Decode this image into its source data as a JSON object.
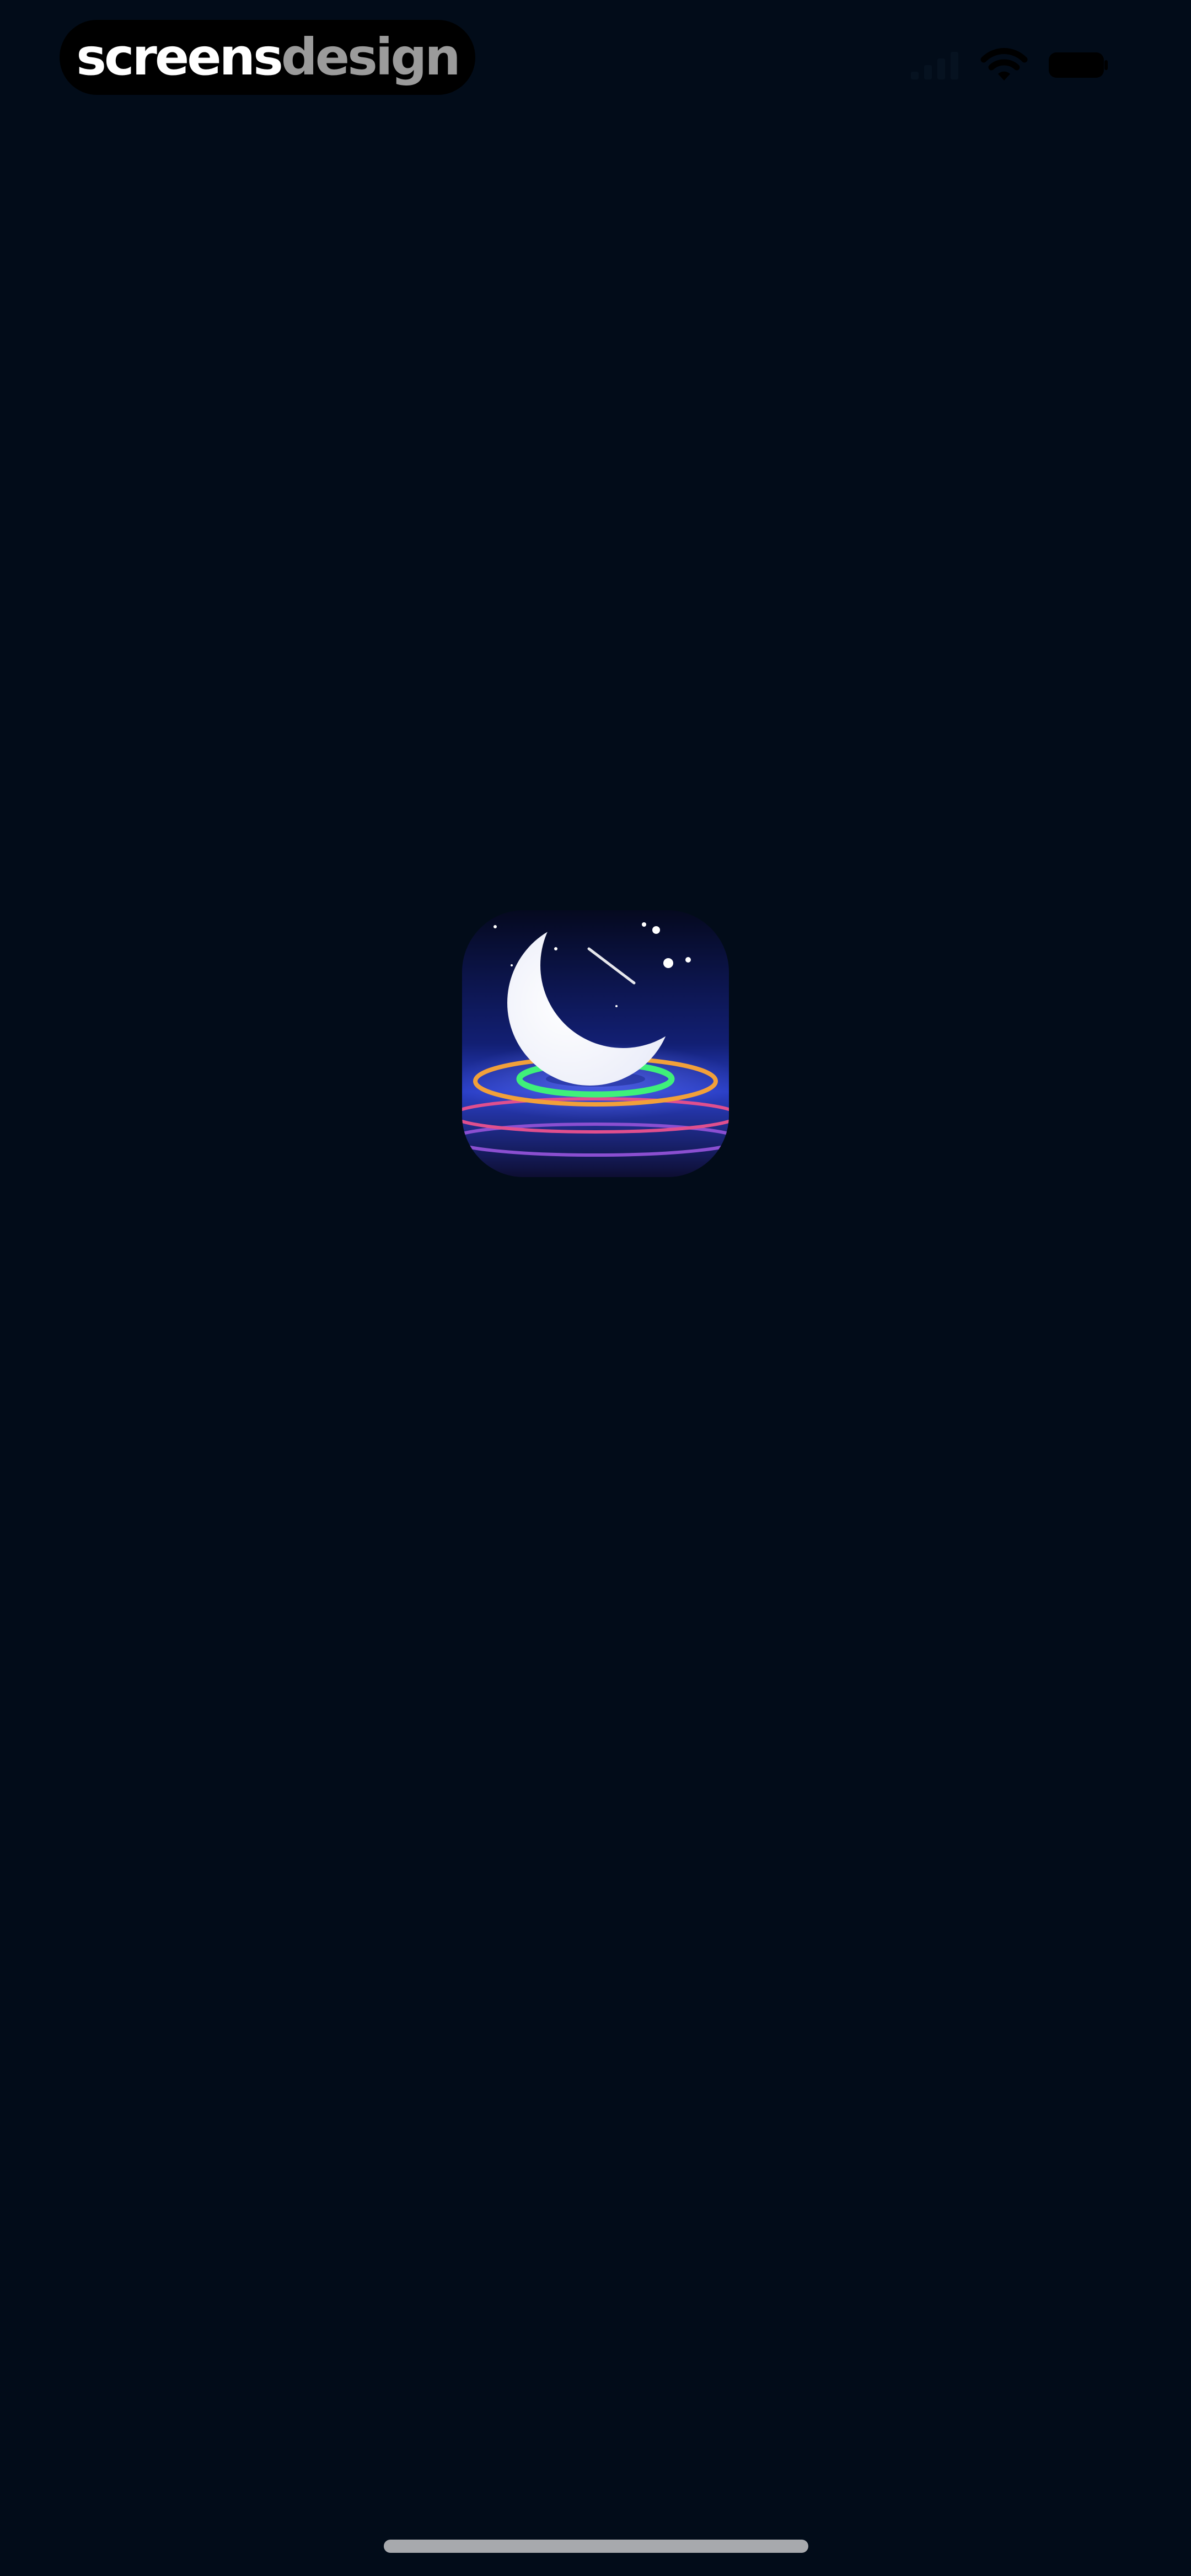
{
  "watermark": {
    "part1": "screens",
    "part2": "design"
  },
  "status_bar": {
    "icons": [
      "cellular-signal-icon",
      "wifi-icon",
      "battery-icon"
    ]
  },
  "splash": {
    "icon": "crescent-moon-app-icon",
    "colors": {
      "background": "#020c19",
      "accent": "#2a3fc7"
    }
  },
  "home_indicator": {
    "icon": "home-indicator"
  }
}
